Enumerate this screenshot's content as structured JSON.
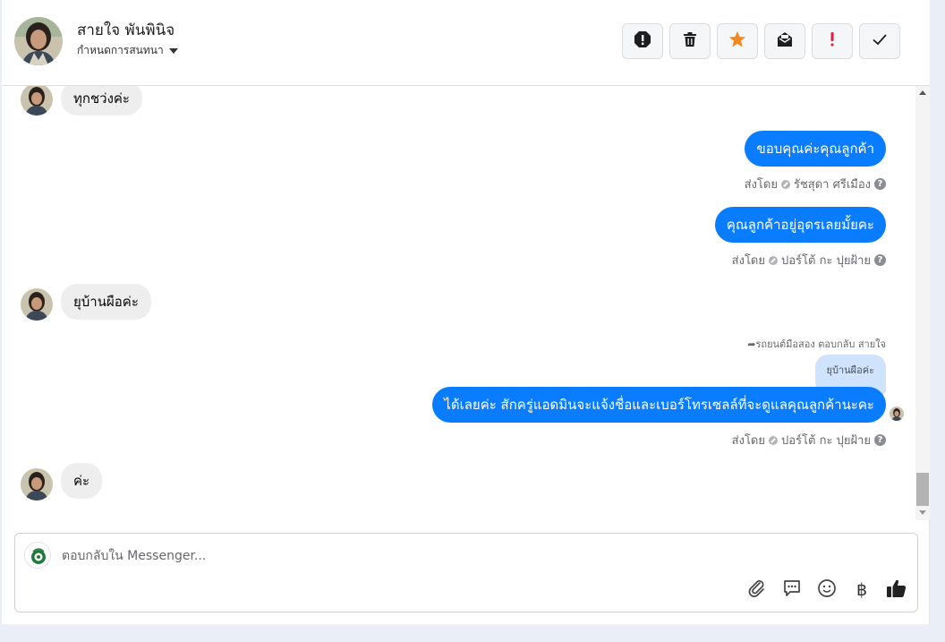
{
  "contact": {
    "name": "สายใจ พันพินิจ",
    "assign_label": "กำหนดการสนทนา"
  },
  "toolbar": {
    "buttons": [
      {
        "icon": "spam-icon",
        "label": "Spam"
      },
      {
        "icon": "trash-icon",
        "label": "Delete"
      },
      {
        "icon": "star-icon",
        "label": "Star"
      },
      {
        "icon": "mark-unread-icon",
        "label": "Mark unread"
      },
      {
        "icon": "follow-up-icon",
        "label": "Follow up"
      },
      {
        "icon": "check-icon",
        "label": "Done"
      }
    ],
    "star_color": "#f2891f",
    "follow_up_color": "#e41e3f"
  },
  "messages": {
    "m1": {
      "text": "ทุกชว่งค่ะ"
    },
    "m2": {
      "text": "ขอบคุณค่ะคุณลูกค้า",
      "sent_by_label": "ส่งโดย",
      "sender": "รัชสุดา ศรีเมือง"
    },
    "m3": {
      "text": "คุณลูกค้าอยู่อุดรเลยมั้ยคะ",
      "sent_by_label": "ส่งโดย",
      "sender": "ปอร์โต้ กะ ปุยฝ้าย"
    },
    "m4": {
      "text": "ยุบ้านผือค่ะ"
    },
    "m5": {
      "reply_note": "รถยนต์มือสอง ตอบกลับ สายใจ",
      "quoted": "ยุบ้านผือค่ะ",
      "text": "ได้เลยค่ะ สักครู่แอดมินจะแจ้งชื่อและเบอร์โทรเซลล์ที่จะดูแลคุณลูกค้านะคะ",
      "sent_by_label": "ส่งโดย",
      "sender": "ปอร์โต้ กะ ปุยฝ้าย"
    },
    "m6": {
      "text": "ค่ะ"
    }
  },
  "composer": {
    "placeholder": "ตอบกลับใน Messenger...",
    "tools": [
      "paperclip-icon",
      "saved-reply-icon",
      "emoji-icon",
      "baht-icon",
      "thumbs-up-icon"
    ],
    "baht_symbol": "฿"
  },
  "colors": {
    "outgoing_bubble": "#0a7cff",
    "incoming_bubble": "#eeeeee",
    "quoted_bubble": "#cfe3fd"
  }
}
